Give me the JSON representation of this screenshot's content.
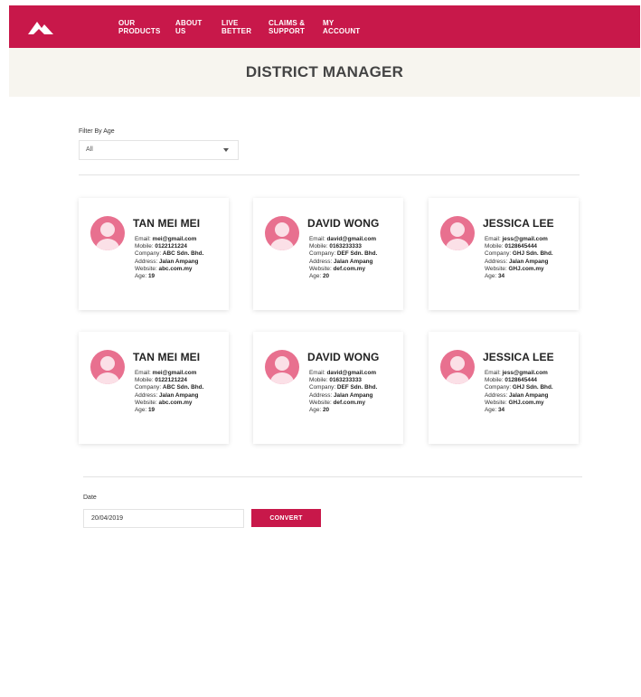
{
  "brand": {
    "accent_color": "#c8184a",
    "logo_icon": "mountain-logo-icon"
  },
  "nav": {
    "items": [
      {
        "label": "OUR\nPRODUCTS"
      },
      {
        "label": "ABOUT\nUS"
      },
      {
        "label": "LIVE\nBETTER"
      },
      {
        "label": "CLAIMS &\nSUPPORT"
      },
      {
        "label": "MY\nACCOUNT"
      }
    ]
  },
  "page": {
    "title": "DISTRICT MANAGER"
  },
  "filter": {
    "label": "Filter By Age",
    "selected": "All"
  },
  "field_labels": {
    "email": "Email: ",
    "mobile": "Mobile: ",
    "company": "Company: ",
    "address": "Address: ",
    "website": "Website: ",
    "age": "Age: "
  },
  "cards": [
    {
      "name": "TAN MEI MEI",
      "email": "mei@gmail.com",
      "mobile": "0122121224",
      "company": "ABC Sdn. Bhd.",
      "address": "Jalan Ampang",
      "website": "abc.com.my",
      "age": "19"
    },
    {
      "name": "DAVID WONG",
      "email": "david@gmail.com",
      "mobile": "0163233333",
      "company": "DEF Sdn. Bhd.",
      "address": "Jalan Ampang",
      "website": "def.com.my",
      "age": "20"
    },
    {
      "name": "JESSICA LEE",
      "email": "jess@gmail.com",
      "mobile": "0128645444",
      "company": "GHJ Sdn. Bhd.",
      "address": "Jalan Ampang",
      "website": "GHJ.com.my",
      "age": "34"
    },
    {
      "name": "TAN MEI MEI",
      "email": "mei@gmail.com",
      "mobile": "0122121224",
      "company": "ABC Sdn. Bhd.",
      "address": "Jalan Ampang",
      "website": "abc.com.my",
      "age": "19"
    },
    {
      "name": "DAVID WONG",
      "email": "david@gmail.com",
      "mobile": "0163233333",
      "company": "DEF Sdn. Bhd.",
      "address": "Jalan Ampang",
      "website": "def.com.my",
      "age": "20"
    },
    {
      "name": "JESSICA LEE",
      "email": "jess@gmail.com",
      "mobile": "0128645444",
      "company": "GHJ Sdn. Bhd.",
      "address": "Jalan Ampang",
      "website": "GHJ.com.my",
      "age": "34"
    }
  ],
  "avatar": {
    "icon": "user-avatar-icon",
    "color": "#e8708f"
  },
  "date": {
    "label": "Date",
    "value": "20/04/2019"
  },
  "convert": {
    "label": "CONVERT"
  }
}
